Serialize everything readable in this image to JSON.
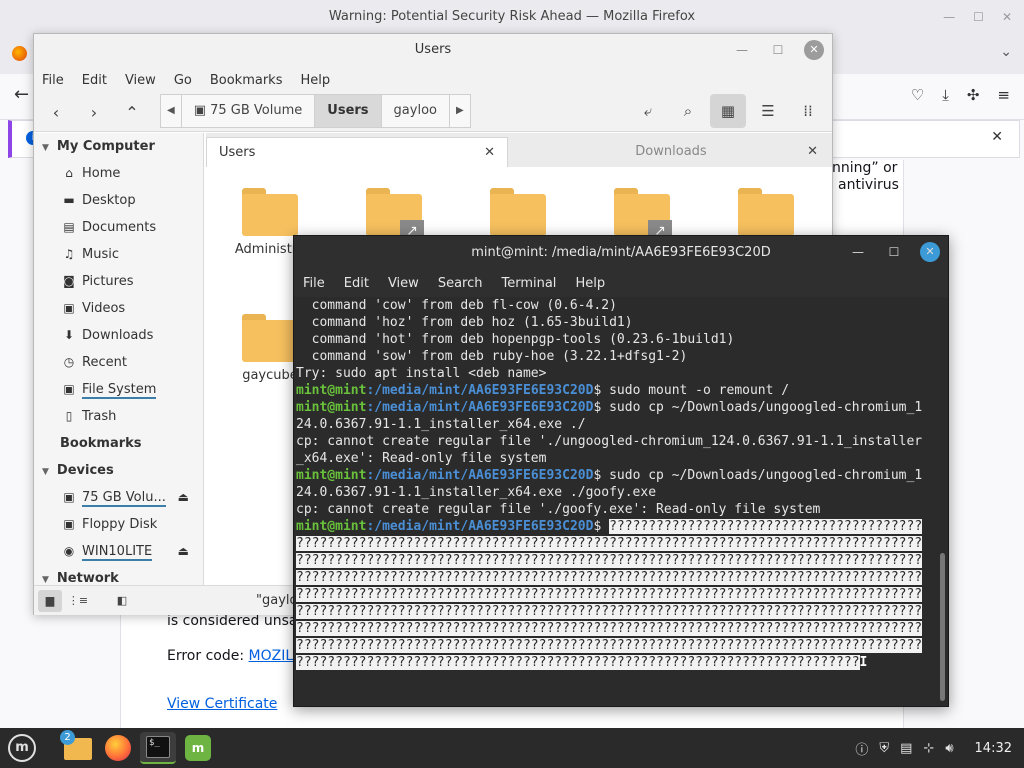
{
  "firefox": {
    "window_title": "Warning: Potential Security Risk Ahead — Mozilla Firefox",
    "body_text_right_1": "nning” or",
    "body_text_right_2": "antivirus",
    "body_text_left": "is considered unsa",
    "error_code_label": "Error code:",
    "error_code_link": "MOZIL",
    "view_certificate": "View Certificate"
  },
  "nemo": {
    "title": "Users",
    "menu": [
      "File",
      "Edit",
      "View",
      "Go",
      "Bookmarks",
      "Help"
    ],
    "pathbar": [
      "75 GB Volume",
      "Users",
      "gayloo"
    ],
    "sidebar": {
      "my_computer": "My Computer",
      "places": [
        {
          "label": "Home",
          "icon": "home-icon"
        },
        {
          "label": "Desktop",
          "icon": "desktop-icon"
        },
        {
          "label": "Documents",
          "icon": "documents-icon"
        },
        {
          "label": "Music",
          "icon": "music-icon"
        },
        {
          "label": "Pictures",
          "icon": "pictures-icon"
        },
        {
          "label": "Videos",
          "icon": "videos-icon"
        },
        {
          "label": "Downloads",
          "icon": "downloads-icon"
        },
        {
          "label": "Recent",
          "icon": "recent-icon"
        },
        {
          "label": "File System",
          "icon": "drive-icon"
        },
        {
          "label": "Trash",
          "icon": "trash-icon"
        }
      ],
      "bookmarks": "Bookmarks",
      "devices_header": "Devices",
      "devices": [
        {
          "label": "75 GB Volu...",
          "icon": "drive-icon",
          "eject": true
        },
        {
          "label": "Floppy Disk",
          "icon": "floppy-icon",
          "eject": false
        },
        {
          "label": "WIN10LITE",
          "icon": "disc-icon",
          "eject": true
        }
      ],
      "network": "Network"
    },
    "tabs": [
      "Users",
      "Downloads"
    ],
    "folders": [
      {
        "label": "Administra",
        "link": false
      },
      {
        "label": "",
        "link": true
      },
      {
        "label": "",
        "link": false
      },
      {
        "label": "",
        "link": true
      },
      {
        "label": "",
        "link": false
      },
      {
        "label": "gaycube",
        "link": false
      }
    ],
    "status_text": "\"gaylo"
  },
  "terminal": {
    "title": "mint@mint: /media/mint/AA6E93FE6E93C20D",
    "menu": [
      "File",
      "Edit",
      "View",
      "Search",
      "Terminal",
      "Help"
    ],
    "lines": [
      "  command 'cow' from deb fl-cow (0.6-4.2)",
      "  command 'hoz' from deb hoz (1.65-3build1)",
      "  command 'hot' from deb hopenpgp-tools (0.23.6-1build1)",
      "  command 'sow' from deb ruby-hoe (3.22.1+dfsg1-2)",
      "Try: sudo apt install <deb name>"
    ],
    "prompt_user": "mint@mint",
    "prompt_path": ":/media/mint/AA6E93FE6E93C20D",
    "prompt_symbol": "$ ",
    "cmd1": "sudo mount -o remount /",
    "cmd2a": "sudo cp ~/Downloads/ungoogled-chromium_1",
    "cmd2b": "24.0.6367.91-1.1_installer_x64.exe ./",
    "err1a": "cp: cannot create regular file './ungoogled-chromium_124.0.6367.91-1.1_installer",
    "err1b": "_x64.exe': Read-only file system",
    "cmd3a": "sudo cp ~/Downloads/ungoogled-chromium_1",
    "cmd3b": "24.0.6367.91-1.1_installer_x64.exe ./goofy.exe",
    "err2": "cp: cannot create regular file './goofy.exe': Read-only file system",
    "garbage_first": "????????????????????????????????????????",
    "garbage_full": "????????????????????????????????????????????????????????????????????????????????",
    "garbage_last": "????????????????????????????????????????????????????????????????????????"
  },
  "taskbar": {
    "files_badge": "2",
    "term_glyph": "$_",
    "clock": "14:32"
  }
}
